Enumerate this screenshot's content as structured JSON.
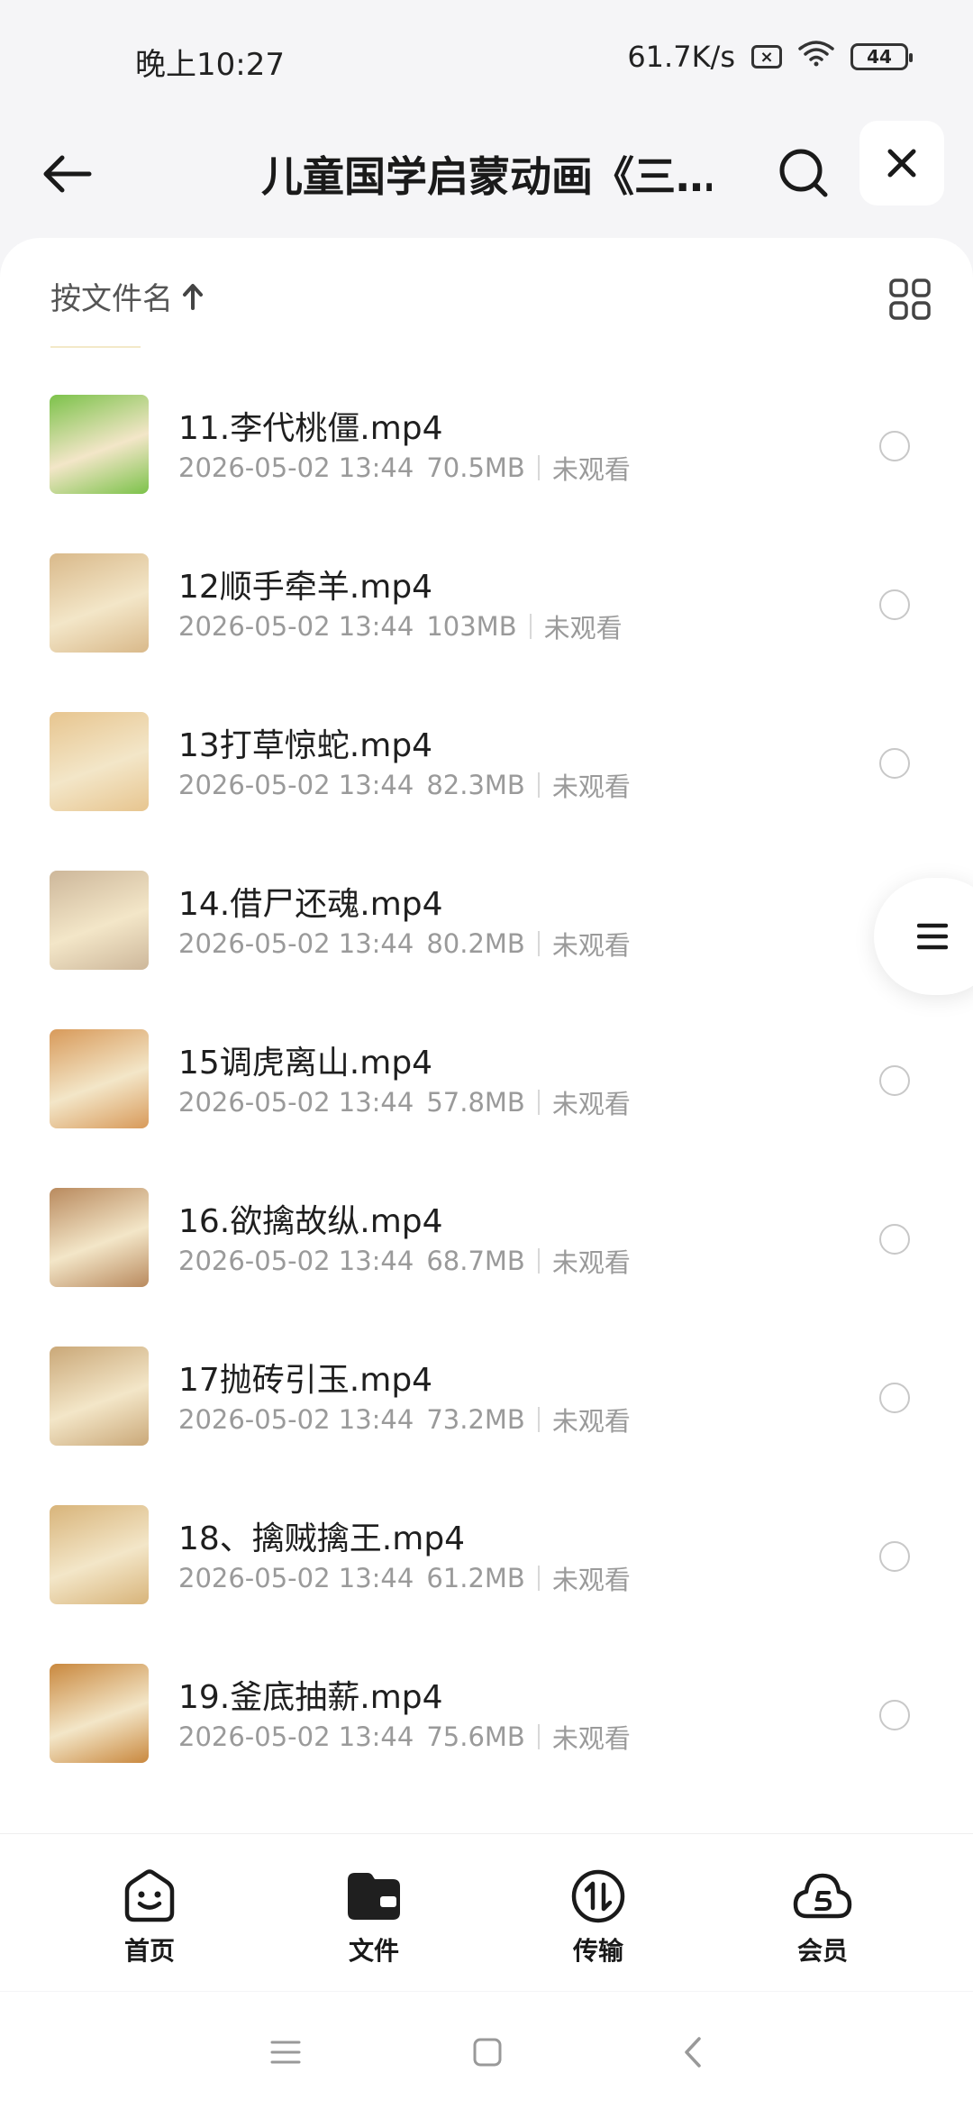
{
  "status_bar": {
    "time": "晚上10:27",
    "network_speed": "61.7K/s",
    "battery": "44"
  },
  "header": {
    "title": "儿童国学启蒙动画《三…",
    "back_icon": "arrow-left-icon",
    "search_icon": "search-icon",
    "close_icon": "close-icon"
  },
  "toolbar": {
    "sort_label": "按文件名",
    "sort_icon": "arrow-up-icon",
    "view_icon": "grid-view-icon"
  },
  "files": [
    {
      "name": "11.李代桃僵.mp4",
      "date": "2026-05-02 13:44",
      "size": "70.5MB",
      "status": "未观看",
      "thumb_color": "#7cc24a"
    },
    {
      "name": "12顺手牵羊.mp4",
      "date": "2026-05-02 13:44",
      "size": "103MB",
      "status": "未观看",
      "thumb_color": "#d9b98a"
    },
    {
      "name": "13打草惊蛇.mp4",
      "date": "2026-05-02 13:44",
      "size": "82.3MB",
      "status": "未观看",
      "thumb_color": "#e7c58f"
    },
    {
      "name": "14.借尸还魂.mp4",
      "date": "2026-05-02 13:44",
      "size": "80.2MB",
      "status": "未观看",
      "thumb_color": "#cdb79a"
    },
    {
      "name": "15调虎离山.mp4",
      "date": "2026-05-02 13:44",
      "size": "57.8MB",
      "status": "未观看",
      "thumb_color": "#d89a5a"
    },
    {
      "name": "16.欲擒故纵.mp4",
      "date": "2026-05-02 13:44",
      "size": "68.7MB",
      "status": "未观看",
      "thumb_color": "#b98a5e"
    },
    {
      "name": "17抛砖引玉.mp4",
      "date": "2026-05-02 13:44",
      "size": "73.2MB",
      "status": "未观看",
      "thumb_color": "#caa878"
    },
    {
      "name": "18、擒贼擒王.mp4",
      "date": "2026-05-02 13:44",
      "size": "61.2MB",
      "status": "未观看",
      "thumb_color": "#d8b47a"
    },
    {
      "name": "19.釜底抽薪.mp4",
      "date": "2026-05-02 13:44",
      "size": "75.6MB",
      "status": "未观看",
      "thumb_color": "#c9883e"
    }
  ],
  "bottom_nav": [
    {
      "label": "首页",
      "icon": "home-smile-icon"
    },
    {
      "label": "文件",
      "icon": "folder-icon"
    },
    {
      "label": "传输",
      "icon": "transfer-icon"
    },
    {
      "label": "会员",
      "icon": "vip-cloud-icon"
    }
  ],
  "colors": {
    "background": "#f5f5f7",
    "card": "#ffffff",
    "meta_text": "#9a9a9a"
  }
}
